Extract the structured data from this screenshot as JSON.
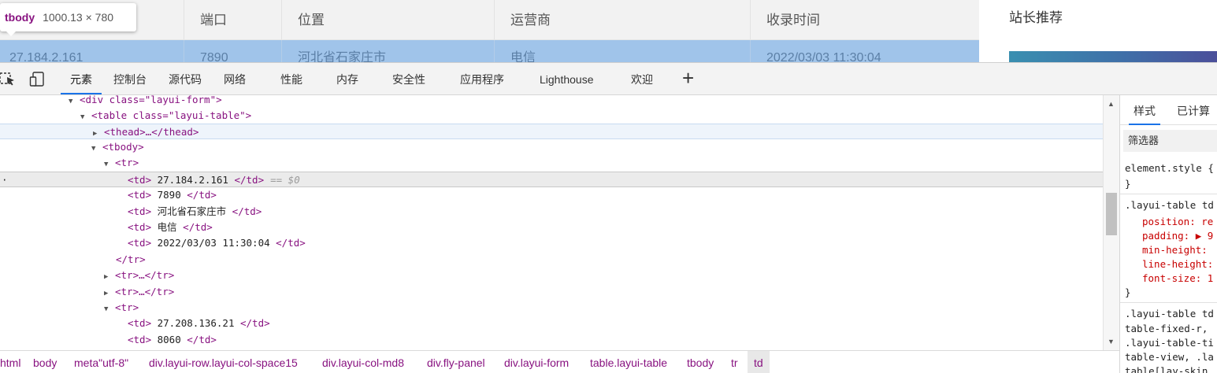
{
  "page": {
    "table_headers": [
      "",
      "端口",
      "位置",
      "运营商",
      "收录时间"
    ],
    "highlighted_row": [
      "27.184.2.161",
      "7890",
      "河北省石家庄市",
      "电信",
      "2022/03/03 11:30:04"
    ],
    "side_title": "站长推荐"
  },
  "tooltip": {
    "tag": "tbody",
    "size": "1000.13 × 780"
  },
  "devtools": {
    "tabs": [
      "元素",
      "控制台",
      "源代码",
      "网络",
      "性能",
      "内存",
      "安全性",
      "应用程序",
      "Lighthouse",
      "欢迎"
    ],
    "active_tab": "元素",
    "dom": {
      "l0": "<div class=\"layui-form\">",
      "l1": "<table class=\"layui-table\">",
      "l2": "<thead>…</thead>",
      "l3": "<tbody>",
      "l4": "<tr>",
      "l5": {
        "open": "<td>",
        "text": " 27.184.2.161 ",
        "close": "</td>",
        "marker": "== $0"
      },
      "l6": {
        "open": "<td>",
        "text": " 7890 ",
        "close": "</td>"
      },
      "l7": {
        "open": "<td>",
        "text": " 河北省石家庄市 ",
        "close": "</td>"
      },
      "l8": {
        "open": "<td>",
        "text": " 电信 ",
        "close": "</td>"
      },
      "l9": {
        "open": "<td>",
        "text": " 2022/03/03 11:30:04 ",
        "close": "</td>"
      },
      "l10": "</tr>",
      "l11": "<tr>…</tr>",
      "l12": "<tr>…</tr>",
      "l13": "<tr>",
      "l14": {
        "open": "<td>",
        "text": " 27.208.136.21 ",
        "close": "</td>"
      },
      "l15": {
        "open": "<td>",
        "text": " 8060 ",
        "close": "</td>"
      }
    },
    "styles": {
      "tabs": [
        "样式",
        "已计算"
      ],
      "filter_placeholder": "筛选器",
      "lines": [
        "element.style {",
        "}",
        ".layui-table td",
        "position: re",
        "padding: ▶ 9",
        "min-height:",
        "line-height:",
        "font-size: 1",
        "}",
        ".layui-table td",
        "table-fixed-r,",
        ".layui-table-ti",
        "table-view, .la",
        "table[lay-skin"
      ]
    },
    "breadcrumb": [
      "html",
      "body",
      "meta\"utf-8\"",
      "div.layui-row.layui-col-space15",
      "div.layui-col-md8",
      "div.fly-panel",
      "div.layui-form",
      "table.layui-table",
      "tbody",
      "tr",
      "td"
    ],
    "breadcrumb_active": "td"
  },
  "colors": {
    "accent": "#1a73e8",
    "tag": "#881280",
    "attr_name": "#994500",
    "attr_value": "#1a1aa6",
    "row_highlight": "#a0c4ea"
  }
}
